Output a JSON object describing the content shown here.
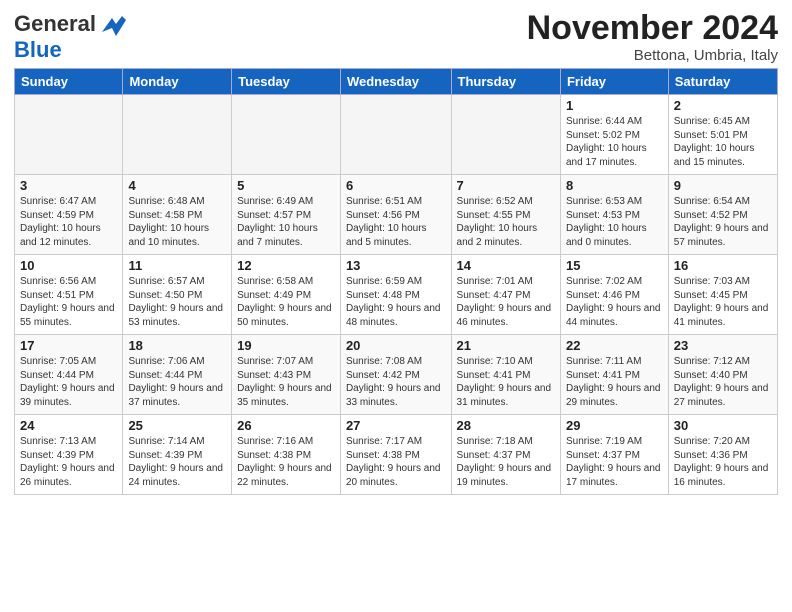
{
  "logo": {
    "general": "General",
    "blue": "Blue"
  },
  "title": "November 2024",
  "location": "Bettona, Umbria, Italy",
  "days_of_week": [
    "Sunday",
    "Monday",
    "Tuesday",
    "Wednesday",
    "Thursday",
    "Friday",
    "Saturday"
  ],
  "weeks": [
    [
      {
        "day": "",
        "info": ""
      },
      {
        "day": "",
        "info": ""
      },
      {
        "day": "",
        "info": ""
      },
      {
        "day": "",
        "info": ""
      },
      {
        "day": "",
        "info": ""
      },
      {
        "day": "1",
        "info": "Sunrise: 6:44 AM\nSunset: 5:02 PM\nDaylight: 10 hours and 17 minutes."
      },
      {
        "day": "2",
        "info": "Sunrise: 6:45 AM\nSunset: 5:01 PM\nDaylight: 10 hours and 15 minutes."
      }
    ],
    [
      {
        "day": "3",
        "info": "Sunrise: 6:47 AM\nSunset: 4:59 PM\nDaylight: 10 hours and 12 minutes."
      },
      {
        "day": "4",
        "info": "Sunrise: 6:48 AM\nSunset: 4:58 PM\nDaylight: 10 hours and 10 minutes."
      },
      {
        "day": "5",
        "info": "Sunrise: 6:49 AM\nSunset: 4:57 PM\nDaylight: 10 hours and 7 minutes."
      },
      {
        "day": "6",
        "info": "Sunrise: 6:51 AM\nSunset: 4:56 PM\nDaylight: 10 hours and 5 minutes."
      },
      {
        "day": "7",
        "info": "Sunrise: 6:52 AM\nSunset: 4:55 PM\nDaylight: 10 hours and 2 minutes."
      },
      {
        "day": "8",
        "info": "Sunrise: 6:53 AM\nSunset: 4:53 PM\nDaylight: 10 hours and 0 minutes."
      },
      {
        "day": "9",
        "info": "Sunrise: 6:54 AM\nSunset: 4:52 PM\nDaylight: 9 hours and 57 minutes."
      }
    ],
    [
      {
        "day": "10",
        "info": "Sunrise: 6:56 AM\nSunset: 4:51 PM\nDaylight: 9 hours and 55 minutes."
      },
      {
        "day": "11",
        "info": "Sunrise: 6:57 AM\nSunset: 4:50 PM\nDaylight: 9 hours and 53 minutes."
      },
      {
        "day": "12",
        "info": "Sunrise: 6:58 AM\nSunset: 4:49 PM\nDaylight: 9 hours and 50 minutes."
      },
      {
        "day": "13",
        "info": "Sunrise: 6:59 AM\nSunset: 4:48 PM\nDaylight: 9 hours and 48 minutes."
      },
      {
        "day": "14",
        "info": "Sunrise: 7:01 AM\nSunset: 4:47 PM\nDaylight: 9 hours and 46 minutes."
      },
      {
        "day": "15",
        "info": "Sunrise: 7:02 AM\nSunset: 4:46 PM\nDaylight: 9 hours and 44 minutes."
      },
      {
        "day": "16",
        "info": "Sunrise: 7:03 AM\nSunset: 4:45 PM\nDaylight: 9 hours and 41 minutes."
      }
    ],
    [
      {
        "day": "17",
        "info": "Sunrise: 7:05 AM\nSunset: 4:44 PM\nDaylight: 9 hours and 39 minutes."
      },
      {
        "day": "18",
        "info": "Sunrise: 7:06 AM\nSunset: 4:44 PM\nDaylight: 9 hours and 37 minutes."
      },
      {
        "day": "19",
        "info": "Sunrise: 7:07 AM\nSunset: 4:43 PM\nDaylight: 9 hours and 35 minutes."
      },
      {
        "day": "20",
        "info": "Sunrise: 7:08 AM\nSunset: 4:42 PM\nDaylight: 9 hours and 33 minutes."
      },
      {
        "day": "21",
        "info": "Sunrise: 7:10 AM\nSunset: 4:41 PM\nDaylight: 9 hours and 31 minutes."
      },
      {
        "day": "22",
        "info": "Sunrise: 7:11 AM\nSunset: 4:41 PM\nDaylight: 9 hours and 29 minutes."
      },
      {
        "day": "23",
        "info": "Sunrise: 7:12 AM\nSunset: 4:40 PM\nDaylight: 9 hours and 27 minutes."
      }
    ],
    [
      {
        "day": "24",
        "info": "Sunrise: 7:13 AM\nSunset: 4:39 PM\nDaylight: 9 hours and 26 minutes."
      },
      {
        "day": "25",
        "info": "Sunrise: 7:14 AM\nSunset: 4:39 PM\nDaylight: 9 hours and 24 minutes."
      },
      {
        "day": "26",
        "info": "Sunrise: 7:16 AM\nSunset: 4:38 PM\nDaylight: 9 hours and 22 minutes."
      },
      {
        "day": "27",
        "info": "Sunrise: 7:17 AM\nSunset: 4:38 PM\nDaylight: 9 hours and 20 minutes."
      },
      {
        "day": "28",
        "info": "Sunrise: 7:18 AM\nSunset: 4:37 PM\nDaylight: 9 hours and 19 minutes."
      },
      {
        "day": "29",
        "info": "Sunrise: 7:19 AM\nSunset: 4:37 PM\nDaylight: 9 hours and 17 minutes."
      },
      {
        "day": "30",
        "info": "Sunrise: 7:20 AM\nSunset: 4:36 PM\nDaylight: 9 hours and 16 minutes."
      }
    ]
  ]
}
